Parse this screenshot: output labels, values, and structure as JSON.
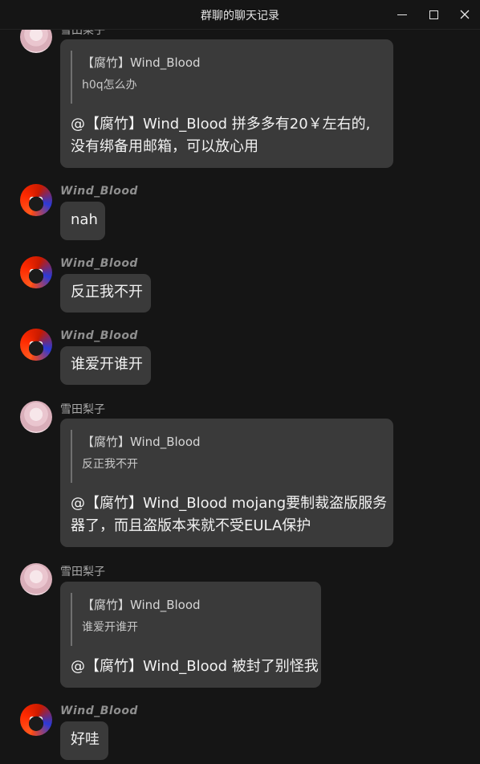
{
  "window": {
    "title": "群聊的聊天记录"
  },
  "messages": [
    {
      "sender": "雪田梨子",
      "quote": {
        "name": "【腐竹】Wind_Blood",
        "text": "h0q怎么办"
      },
      "lines": [
        "@【腐竹】Wind_Blood 拼多多有20￥左右的,",
        "没有绑备用邮箱，可以放心用"
      ]
    },
    {
      "sender": "Wind_Blood",
      "lines": [
        "nah"
      ]
    },
    {
      "sender": "Wind_Blood",
      "lines": [
        "反正我不开"
      ]
    },
    {
      "sender": "Wind_Blood",
      "lines": [
        "谁爱开谁开"
      ]
    },
    {
      "sender": "雪田梨子",
      "quote": {
        "name": "【腐竹】Wind_Blood",
        "text": "反正我不开"
      },
      "lines": [
        "@【腐竹】Wind_Blood mojang要制裁盗版服务",
        "器了，而且盗版本来就不受EULA保护"
      ]
    },
    {
      "sender": "雪田梨子",
      "quote": {
        "name": "【腐竹】Wind_Blood",
        "text": "谁爱开谁开"
      },
      "lines": [
        "@【腐竹】Wind_Blood 被封了别怪我"
      ]
    },
    {
      "sender": "Wind_Blood",
      "lines": [
        "好哇"
      ]
    }
  ]
}
